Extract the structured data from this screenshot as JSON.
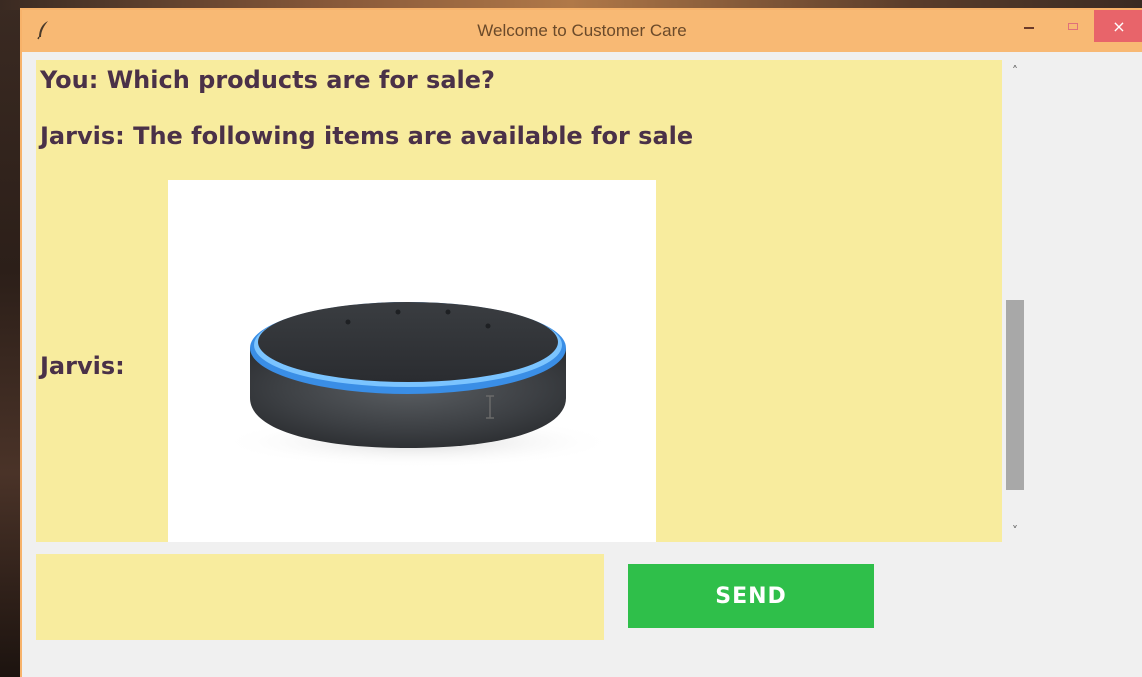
{
  "window": {
    "title": "Welcome to Customer Care",
    "close_glyph": "×"
  },
  "chat": {
    "messages": [
      {
        "text": "You: Which products are for sale?"
      },
      {
        "text": "Jarvis: The following items are available for sale"
      },
      {
        "text": "Jarvis:",
        "attachment": "product-image"
      }
    ]
  },
  "scrollbar": {
    "up_glyph": "˄",
    "down_glyph": "˅"
  },
  "input": {
    "value": ""
  },
  "send": {
    "label": "SEND"
  },
  "colors": {
    "titlebar": "#f8b974",
    "chat_background": "#f8ec9e",
    "text": "#4a3148",
    "send_button": "#2fbf4a",
    "close_button": "#e8646a"
  }
}
